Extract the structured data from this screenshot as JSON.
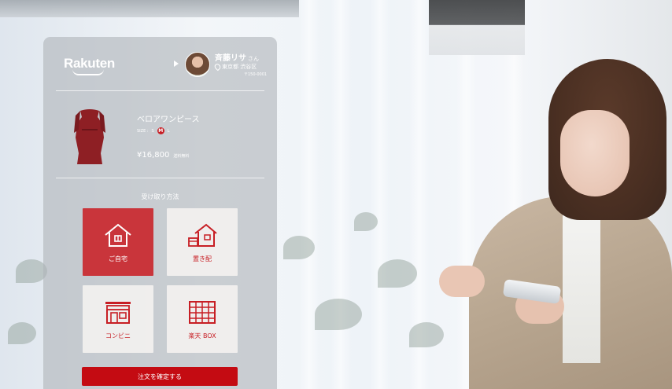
{
  "header": {
    "brand": "Rakuten",
    "user_name": "斉藤リサ",
    "user_suffix": "さん",
    "location": "東京都 渋谷区",
    "postal_code": "〒150-0001"
  },
  "product": {
    "name": "ベロアワンピース",
    "size_label": "SIZE :",
    "sizes": [
      "S",
      "M",
      "L"
    ],
    "selected_size": "M",
    "price": "¥16,800",
    "shipping": "送料無料"
  },
  "delivery": {
    "title": "受け取り方法",
    "options": [
      {
        "label": "ご自宅",
        "icon": "house-icon",
        "selected": true
      },
      {
        "label": "置き配",
        "icon": "drop-off-house-icon",
        "selected": false
      },
      {
        "label": "コンビニ",
        "icon": "convenience-store-icon",
        "selected": false
      },
      {
        "label": "楽天 BOX",
        "icon": "locker-box-icon",
        "selected": false
      }
    ]
  },
  "confirm_label": "注文を確定する",
  "colors": {
    "accent": "#c40b12",
    "selected_tile": "#c9353b",
    "panel": "#b0b4b9"
  }
}
